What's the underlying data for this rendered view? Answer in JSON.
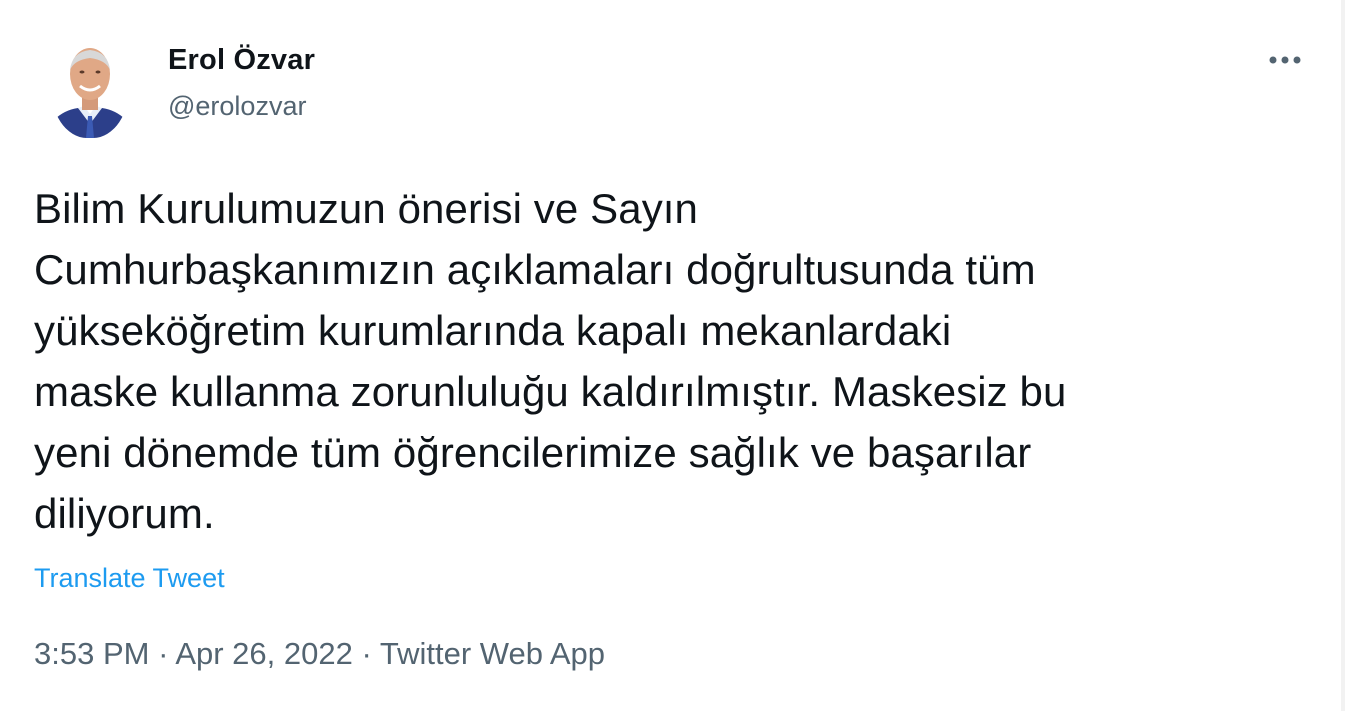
{
  "author": {
    "display_name": "Erol Özvar",
    "handle": "@erolozvar"
  },
  "more_icon": "more-horizontal-icon",
  "tweet": {
    "text": "Bilim Kurulumuzun önerisi ve Sayın\nCumhurbaşkanımızın açıklamaları doğrultusunda tüm\nyükseköğretim kurumlarında kapalı mekanlardaki\nmaske kullanma zorunluluğu kaldırılmıştır. Maskesiz bu\nyeni dönemde tüm öğrencilerimize sağlık ve başarılar\ndiliyorum.",
    "translate_label": "Translate Tweet"
  },
  "meta": {
    "time": "3:53 PM",
    "separator": "·",
    "date": "Apr 26, 2022",
    "source": "Twitter Web App"
  },
  "colors": {
    "link": "#1d9bf0",
    "secondary_text": "#536471",
    "primary_text": "#0f1419"
  }
}
